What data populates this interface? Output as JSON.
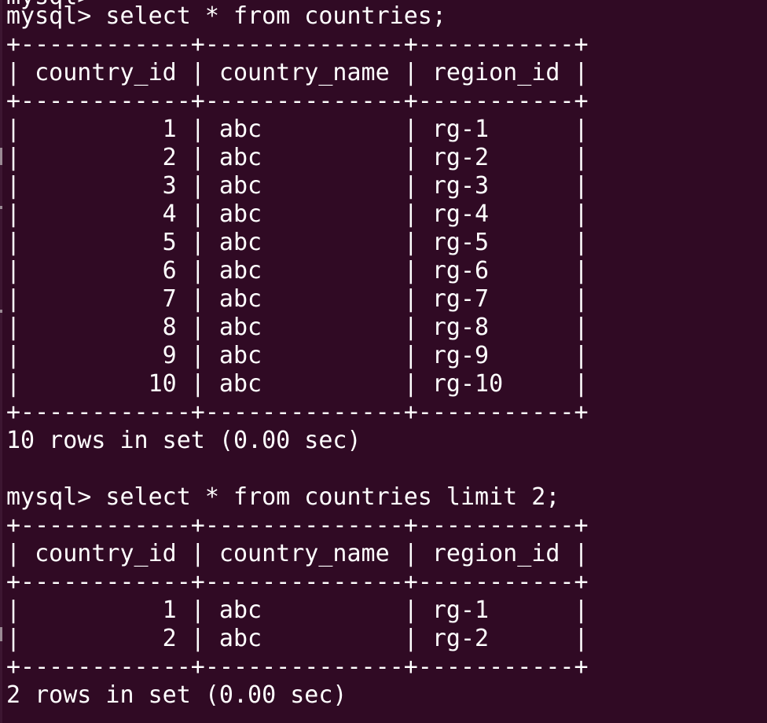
{
  "terminal": {
    "background": "#300a24",
    "foreground": "#ffffff",
    "top_fragment": "mysql> ",
    "lines": [
      "mysql> select * from countries;",
      "+------------+--------------+-----------+",
      "| country_id | country_name | region_id |",
      "+------------+--------------+-----------+",
      "|          1 | abc          | rg-1      |",
      "|          2 | abc          | rg-2      |",
      "|          3 | abc          | rg-3      |",
      "|          4 | abc          | rg-4      |",
      "|          5 | abc          | rg-5      |",
      "|          6 | abc          | rg-6      |",
      "|          7 | abc          | rg-7      |",
      "|          8 | abc          | rg-8      |",
      "|          9 | abc          | rg-9      |",
      "|         10 | abc          | rg-10     |",
      "+------------+--------------+-----------+",
      "10 rows in set (0.00 sec)",
      "",
      "mysql> select * from countries limit 2;",
      "+------------+--------------+-----------+",
      "| country_id | country_name | region_id |",
      "+------------+--------------+-----------+",
      "|          1 | abc          | rg-1      |",
      "|          2 | abc          | rg-2      |",
      "+------------+--------------+-----------+",
      "2 rows in set (0.00 sec)"
    ]
  }
}
